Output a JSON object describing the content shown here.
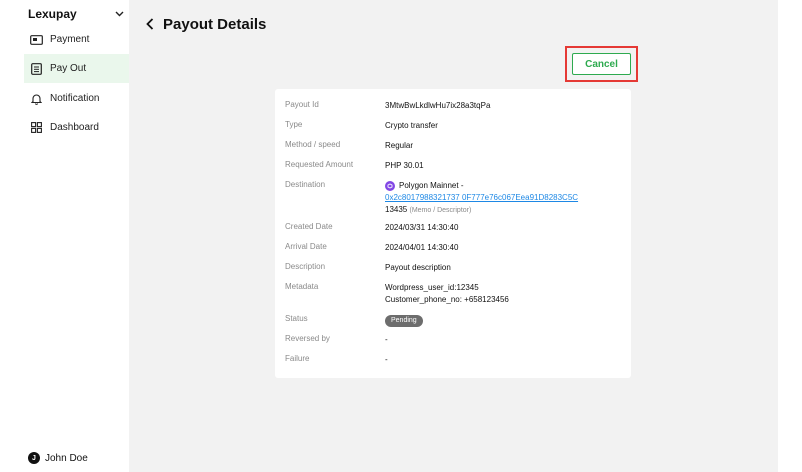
{
  "sidebar": {
    "brand": "Lexupay",
    "items": [
      {
        "label": "Payment",
        "icon": "payment-icon"
      },
      {
        "label": "Pay Out",
        "icon": "payout-icon",
        "active": true
      },
      {
        "label": "Notification",
        "icon": "bell-icon"
      },
      {
        "label": "Dashboard",
        "icon": "dashboard-icon"
      }
    ],
    "user": {
      "initial": "J",
      "name": "John Doe"
    }
  },
  "header": {
    "title": "Payout Details"
  },
  "actions": {
    "cancel_label": "Cancel"
  },
  "details": {
    "payout_id": {
      "label": "Payout Id",
      "value": "3MtwBwLkdlwHu7ix28a3tqPa"
    },
    "type": {
      "label": "Type",
      "value": "Crypto transfer"
    },
    "method": {
      "label": "Method / speed",
      "value": "Regular"
    },
    "amount": {
      "label": "Requested Amount",
      "value": "PHP 30.01"
    },
    "destination": {
      "label": "Destination",
      "network": "Polygon Mainnet -",
      "address": "0x2c8017988321737 0F777e76c067Eea91D8283C5C",
      "memo": "13435",
      "memo_hint": "(Memo / Descriptor)"
    },
    "created": {
      "label": "Created Date",
      "value": "2024/03/31 14:30:40"
    },
    "arrival": {
      "label": "Arrival Date",
      "value": "2024/04/01 14:30:40"
    },
    "description": {
      "label": "Description",
      "value": "Payout description"
    },
    "metadata": {
      "label": "Metadata",
      "line1": "Wordpress_user_id:12345",
      "line2": "Customer_phone_no: +658123456"
    },
    "status": {
      "label": "Status",
      "value": "Pending",
      "color": "#6d6d6d"
    },
    "reversed_by": {
      "label": "Reversed by",
      "value": "-"
    },
    "failure": {
      "label": "Failure",
      "value": "-"
    }
  },
  "colors": {
    "accent": "#2eaa4f",
    "highlight": "#e53935",
    "link": "#1e88e5",
    "active_nav": "#eaf7ec"
  }
}
